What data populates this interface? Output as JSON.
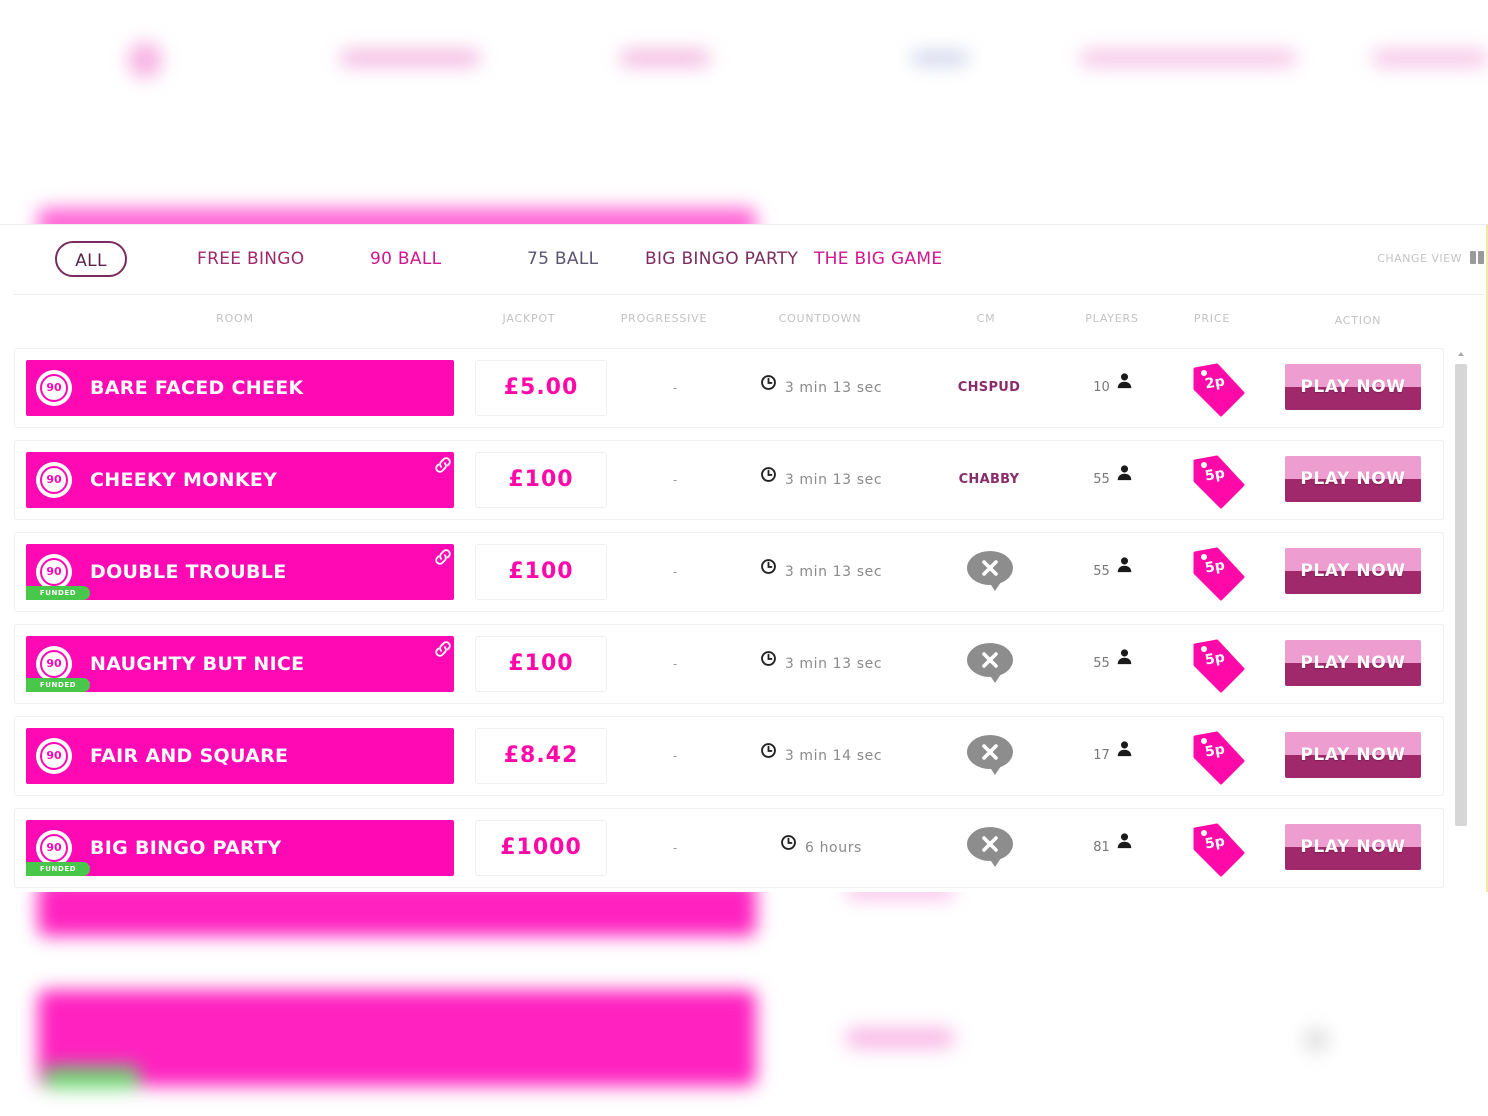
{
  "filters": {
    "all": "ALL",
    "free_bingo": "FREE BINGO",
    "ball90": "90 BALL",
    "ball75": "75 BALL",
    "big_bingo_party": "BIG BINGO PARTY",
    "the_big_game": "THE BIG GAME",
    "change_view": "CHANGE VIEW"
  },
  "columns": {
    "room": "ROOM",
    "jackpot": "JACKPOT",
    "progressive": "PROGRESSIVE",
    "countdown": "COUNTDOWN",
    "cm": "CM",
    "players": "PLAYERS",
    "price": "PRICE",
    "action": "ACTION"
  },
  "rows": [
    {
      "ball": "90",
      "name": "BARE FACED CHEEK",
      "linked": false,
      "funded": false,
      "jackpot": "£5.00",
      "progressive": "-",
      "countdown": "3 min 13 sec",
      "cm": "CHSPUD",
      "players": "10",
      "price": "2p",
      "action": "PLAY NOW"
    },
    {
      "ball": "90",
      "name": "CHEEKY MONKEY",
      "linked": true,
      "funded": false,
      "jackpot": "£100",
      "progressive": "-",
      "countdown": "3 min 13 sec",
      "cm": "CHABBY",
      "players": "55",
      "price": "5p",
      "action": "PLAY NOW"
    },
    {
      "ball": "90",
      "name": "DOUBLE TROUBLE",
      "linked": true,
      "funded": true,
      "funded_label": "FUNDED",
      "jackpot": "£100",
      "progressive": "-",
      "countdown": "3 min 13 sec",
      "cm": "",
      "players": "55",
      "price": "5p",
      "action": "PLAY NOW"
    },
    {
      "ball": "90",
      "name": "NAUGHTY BUT NICE",
      "linked": true,
      "funded": true,
      "funded_label": "FUNDED",
      "jackpot": "£100",
      "progressive": "-",
      "countdown": "3 min 13 sec",
      "cm": "",
      "players": "55",
      "price": "5p",
      "action": "PLAY NOW"
    },
    {
      "ball": "90",
      "name": "FAIR AND SQUARE",
      "linked": false,
      "funded": false,
      "jackpot": "£8.42",
      "progressive": "-",
      "countdown": "3 min 14 sec",
      "cm": "",
      "players": "17",
      "price": "5p",
      "action": "PLAY NOW"
    },
    {
      "ball": "90",
      "name": "BIG BINGO PARTY",
      "linked": false,
      "funded": true,
      "funded_label": "FUNDED",
      "jackpot": "£1000",
      "progressive": "-",
      "countdown": "6 hours",
      "cm": "",
      "players": "81",
      "price": "5p",
      "action": "PLAY NOW"
    }
  ],
  "icons": {
    "ball": "bingo-ball-icon",
    "link": "link-icon",
    "clock": "clock-icon",
    "cm_none": "no-chat-moderator-icon",
    "players": "person-icon",
    "price": "price-tag-icon",
    "change_view": "grid-view-icon"
  },
  "colors": {
    "brand_pink": "#ff09b5",
    "dark_magenta": "#8a2c6a",
    "play_top": "#ee9dd1",
    "play_bottom": "#a0296b",
    "funded_green": "#48c74a",
    "free_bingo": "#a0296b",
    "ball90": "#d0168f",
    "ball75": "#5c5572",
    "big_bingo_party": "#7b2d5f",
    "the_big_game": "#d0168f"
  }
}
